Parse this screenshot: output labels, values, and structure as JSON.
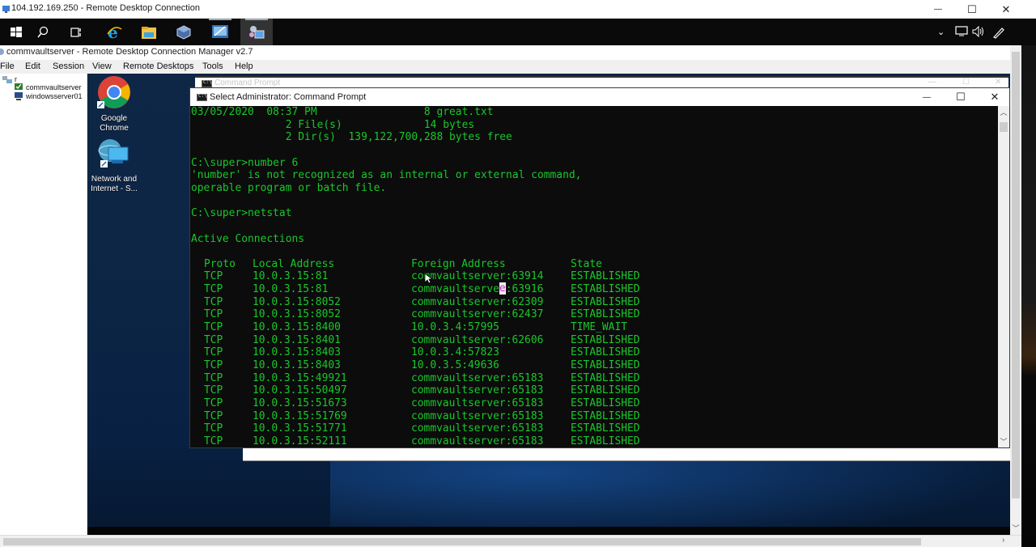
{
  "rdp_window": {
    "title": "104.192.169.250 - Remote Desktop Connection",
    "minimize_glyph": "—",
    "maximize_glyph": "☐",
    "close_glyph": "✕"
  },
  "remote_taskbar": {
    "icons": [
      "windows-start-icon",
      "search-icon",
      "task-view-icon",
      "internet-explorer-icon",
      "file-explorer-icon",
      "virtualbox-icon",
      "remote-desktop-icon",
      "rdcman-icon"
    ],
    "tray": [
      "chevron-up-icon",
      "network-icon",
      "volume-icon",
      "pen-icon"
    ]
  },
  "rdcman": {
    "title": "commvaultserver - Remote Desktop Connection Manager v2.7",
    "menu": [
      "File",
      "Edit",
      "Session",
      "View",
      "Remote Desktops",
      "Tools",
      "Help"
    ],
    "tree": {
      "root": "r",
      "servers": [
        "commvaultserver",
        "windowsserver01"
      ]
    }
  },
  "desktop": {
    "icons": [
      {
        "label_line1": "Google",
        "label_line2": "Chrome",
        "icon": "chrome-icon"
      },
      {
        "label_line1": "Network and",
        "label_line2": "Internet - S...",
        "icon": "network-internet-icon"
      }
    ]
  },
  "cmd_back": {
    "title": "Command Prompt"
  },
  "cmd": {
    "title": "Select Administrator: Command Prompt",
    "header_lines": [
      "03/05/2020  08:37 PM                 8 great.txt",
      "               2 File(s)             14 bytes",
      "               2 Dir(s)  139,122,700,288 bytes free",
      "",
      "C:\\super>number 6",
      "'number' is not recognized as an internal or external command,",
      "operable program or batch file.",
      "",
      "C:\\super>netstat",
      "",
      "Active Connections",
      ""
    ],
    "netstat": {
      "columns": [
        "Proto",
        "Local Address",
        "Foreign Address",
        "State"
      ],
      "rows": [
        [
          "TCP",
          "10.0.3.15:81",
          "commvaultserver:63914",
          "ESTABLISHED"
        ],
        [
          "TCP",
          "10.0.3.15:81",
          "commvaultserver:63916",
          "ESTABLISHED"
        ],
        [
          "TCP",
          "10.0.3.15:8052",
          "commvaultserver:62309",
          "ESTABLISHED"
        ],
        [
          "TCP",
          "10.0.3.15:8052",
          "commvaultserver:62437",
          "ESTABLISHED"
        ],
        [
          "TCP",
          "10.0.3.15:8400",
          "10.0.3.4:57995",
          "TIME_WAIT"
        ],
        [
          "TCP",
          "10.0.3.15:8401",
          "commvaultserver:62606",
          "ESTABLISHED"
        ],
        [
          "TCP",
          "10.0.3.15:8403",
          "10.0.3.4:57823",
          "ESTABLISHED"
        ],
        [
          "TCP",
          "10.0.3.15:8403",
          "10.0.3.5:49636",
          "ESTABLISHED"
        ],
        [
          "TCP",
          "10.0.3.15:49921",
          "commvaultserver:65183",
          "ESTABLISHED"
        ],
        [
          "TCP",
          "10.0.3.15:50497",
          "commvaultserver:65183",
          "ESTABLISHED"
        ],
        [
          "TCP",
          "10.0.3.15:51673",
          "commvaultserver:65183",
          "ESTABLISHED"
        ],
        [
          "TCP",
          "10.0.3.15:51769",
          "commvaultserver:65183",
          "ESTABLISHED"
        ],
        [
          "TCP",
          "10.0.3.15:51771",
          "commvaultserver:65183",
          "ESTABLISHED"
        ],
        [
          "TCP",
          "10.0.3.15:52111",
          "commvaultserver:65183",
          "ESTABLISHED"
        ]
      ]
    },
    "text_color": "#19c82a",
    "selection_char": "e"
  }
}
